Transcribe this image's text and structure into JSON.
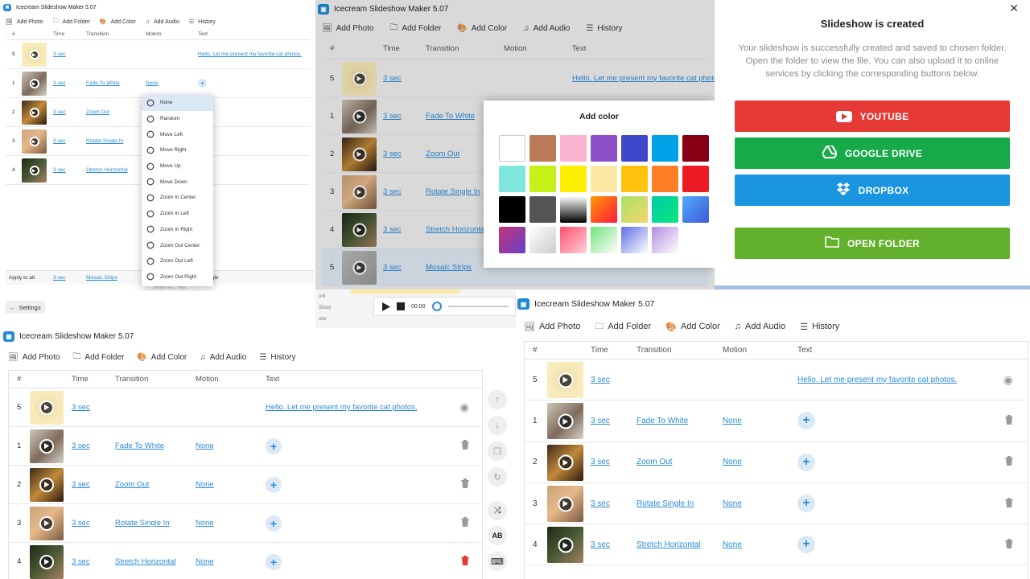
{
  "app_title": "Icecream Slideshow Maker 5.07",
  "toolbar": {
    "add_photo": "Add Photo",
    "add_folder": "Add Folder",
    "add_color": "Add Color",
    "add_audio": "Add Audio",
    "history": "History"
  },
  "columns": {
    "num": "#",
    "time": "Time",
    "transition": "Transition",
    "motion": "Motion",
    "text": "Text"
  },
  "rows": [
    {
      "num": "5",
      "time": "3 sec",
      "transition": "",
      "motion": "",
      "text": "Hello. Let me present my favorite cat photos."
    },
    {
      "num": "1",
      "time": "3 sec",
      "transition": "Fade To White",
      "motion": "None",
      "text": ""
    },
    {
      "num": "2",
      "time": "3 sec",
      "transition": "Zoom Out",
      "motion": "None",
      "text": ""
    },
    {
      "num": "3",
      "time": "3 sec",
      "transition": "Rotate Single In",
      "motion": "None",
      "text": ""
    },
    {
      "num": "4",
      "time": "3 sec",
      "transition": "Stretch Horizontal",
      "motion": "None",
      "text": ""
    }
  ],
  "extra_row": {
    "num": "5",
    "time": "3 sec",
    "transition": "Mosaic Strips"
  },
  "apply_row": {
    "label": "Apply to all:",
    "time": "3 sec",
    "transition": "Mosaic Strips",
    "tail": "gle"
  },
  "settings_label": "Settings",
  "motion_menu": [
    "None",
    "Random",
    "Move Left",
    "Move Right",
    "Move Up",
    "Move Down",
    "Zoom In Center",
    "Zoom In Left",
    "Zoom In Right",
    "Zoom Out Center",
    "Zoom Out Left",
    "Zoom Out Right"
  ],
  "menu_footer": "Session Ex... Help",
  "add_color": {
    "title": "Add color",
    "swatches": [
      "#ffffff",
      "#b97a57",
      "#f7b3d0",
      "#8e4fc8",
      "#3f48cc",
      "#00a2e8",
      "#880015",
      "#7fe7e0",
      "#c5f018",
      "#ffee00",
      "#fde8a6",
      "#ffc20e",
      "#ff7f27",
      "#ed1c24",
      "#000000",
      "#555555",
      "linear-gradient(180deg,#fff,#000)",
      "linear-gradient(135deg,#ff9a00,#ff1a3d)",
      "linear-gradient(135deg,#a8e063,#f5d76e)",
      "linear-gradient(135deg,#00c9a7,#0ae87c)",
      "linear-gradient(135deg,#4facfe,#3f57d5)",
      "linear-gradient(135deg,#c0347a,#6a3fc8)",
      "linear-gradient(135deg,#ffffff,#cccccc)",
      "linear-gradient(135deg,#ff4d6d,#ffd1dc)",
      "linear-gradient(135deg,#6fe37a,#ffffff)",
      "linear-gradient(135deg,#5d6ee6,#ffffff)",
      "linear-gradient(135deg,#b48ce0,#ffffff)"
    ]
  },
  "player": {
    "time": "00:00",
    "side_labels": [
      "unt",
      "Sized",
      "olor"
    ]
  },
  "created": {
    "title": "Slideshow is created",
    "message": "Your slideshow is successfully created and saved to chosen folder. Open the folder to view the file. You can also upload it to online services by clicking the corresponding buttons below.",
    "youtube": "YOUTUBE",
    "gdrive": "GOOGLE DRIVE",
    "dropbox": "DROPBOX",
    "open_folder": "OPEN FOLDER",
    "close": "✕"
  },
  "colors": {
    "accent": "#2a8bd8",
    "youtube": "#e53935",
    "gdrive": "#17a94a",
    "dropbox": "#1b95e0",
    "openfolder": "#63b02c",
    "delete_red": "#e53935"
  }
}
